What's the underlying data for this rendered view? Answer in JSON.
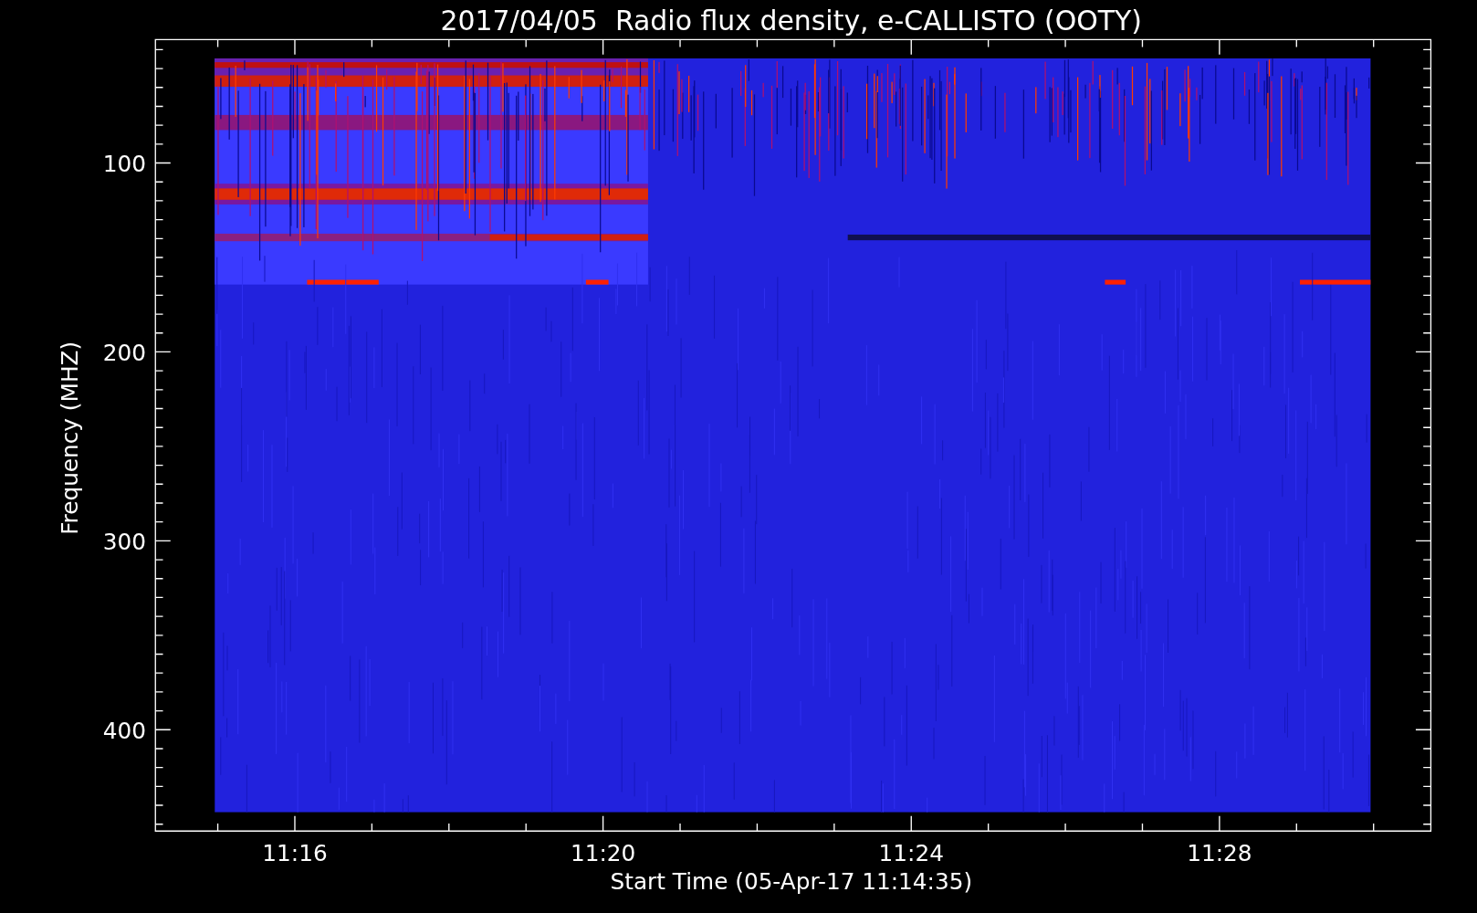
{
  "title": "2017/04/05  Radio flux density, e-CALLISTO (OOTY)",
  "y_axis": {
    "label": "Frequency (MHZ)",
    "ticks": [
      "100",
      "200",
      "300",
      "400"
    ]
  },
  "x_axis": {
    "label": "Start Time (05-Apr-17 11:14:35)",
    "ticks": [
      "11:16",
      "11:20",
      "11:24",
      "11:28"
    ]
  }
}
